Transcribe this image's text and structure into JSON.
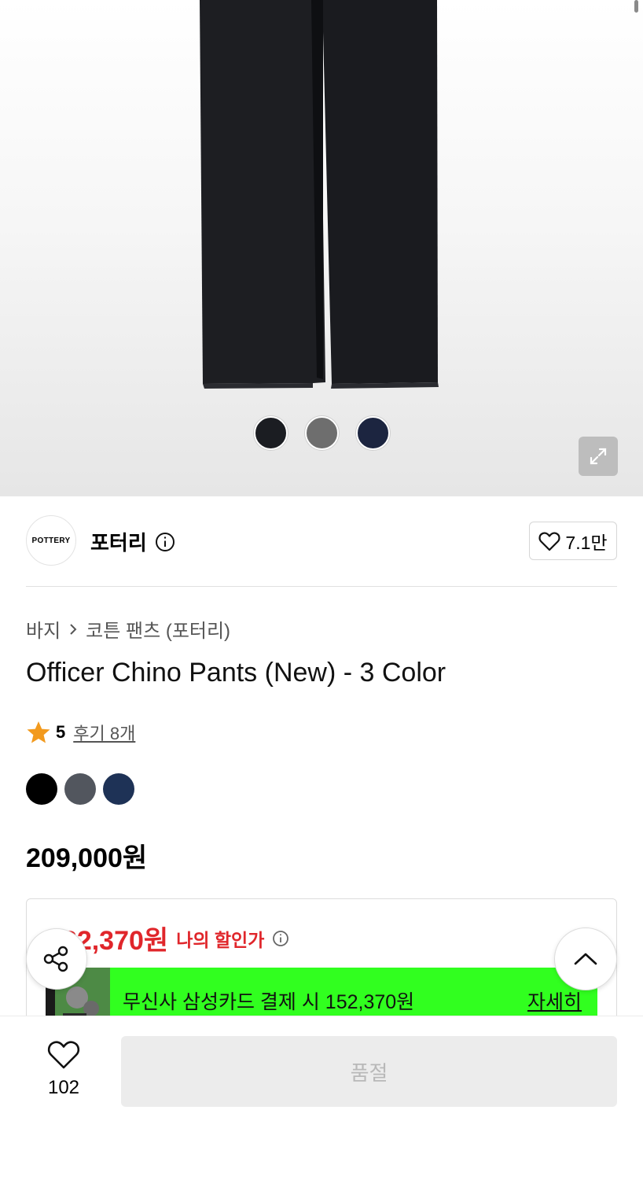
{
  "gallery": {
    "color_dots": [
      {
        "name": "black",
        "color": "#1b1d22"
      },
      {
        "name": "gray",
        "color": "#6e6e6e"
      },
      {
        "name": "navy",
        "color": "#1c2540"
      }
    ]
  },
  "brand": {
    "logo_text": "POTTERY",
    "name": "포터리",
    "like_count": "7.1만"
  },
  "breadcrumb": {
    "category": "바지",
    "subcategory": "코튼 팬츠 (포터리)"
  },
  "product": {
    "title": "Officer Chino Pants (New) - 3 Color",
    "rating": "5",
    "reviews": "후기 8개",
    "colors": [
      {
        "name": "black",
        "color": "#000000"
      },
      {
        "name": "charcoal",
        "color": "#52565e"
      },
      {
        "name": "navy",
        "color": "#1e3256"
      }
    ],
    "price": "209,000원"
  },
  "discount": {
    "my_price": "182,370원",
    "my_price_label": "나의 할인가",
    "card_text": "무신사 삼성카드 결제 시 152,370원",
    "card_detail": "자세히",
    "accent_color": "#e0262b",
    "banner_color": "#31ff1f"
  },
  "bottom_bar": {
    "wish_count": "102",
    "buy_label": "품절"
  }
}
